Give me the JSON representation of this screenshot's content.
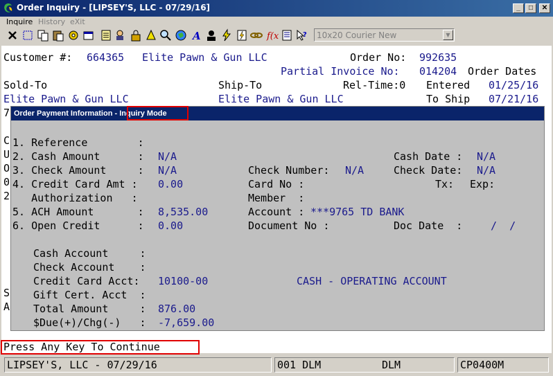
{
  "window": {
    "title": "Order Inquiry - [LIPSEY'S, LLC - 07/29/16]",
    "minimize": "_",
    "maximize": "□",
    "close": "✕"
  },
  "menu": {
    "inquire": "Inquire",
    "history": "History",
    "exit": "eXit"
  },
  "toolbar": {
    "font_select": "10x20 Courier New"
  },
  "header": {
    "customer_label": "Customer #:",
    "customer_number": "664365",
    "customer_name": "Elite Pawn & Gun LLC",
    "order_no_label": "Order No:",
    "order_no": "992635",
    "partial_invoice_label": "Partial Invoice No:",
    "partial_invoice_no": "014204",
    "order_dates_label": "Order Dates",
    "sold_to_label": "Sold-To",
    "ship_to_label": "Ship-To",
    "rel_time_label": "Rel-Time:0",
    "entered_label": "Entered",
    "entered_date": "01/25/16",
    "sold_to_name": "Elite Pawn & Gun LLC",
    "ship_to_name": "Elite Pawn & Gun LLC",
    "to_ship_label": "To Ship",
    "to_ship_date": "07/21/16"
  },
  "background_fragments": {
    "r1": "7",
    "r2": "C",
    "r3": "U",
    "r4": "O",
    "r5": "0",
    "r6": "2",
    "r7": "S",
    "r8": "A"
  },
  "dialog": {
    "title": "Order Payment Information - ",
    "mode": "Inquiry Mode",
    "fields": {
      "reference_label": "1. Reference        :",
      "cash_amount_label": "2. Cash Amount      :",
      "cash_amount": "N/A",
      "cash_date_label": "Cash Date :",
      "cash_date": "N/A",
      "check_amount_label": "3. Check Amount     :",
      "check_amount": "N/A",
      "check_number_label": "Check Number:",
      "check_number": "N/A",
      "check_date_label": "Check Date:",
      "check_date": "N/A",
      "cc_amt_label": "4. Credit Card Amt :",
      "cc_amt": "0.00",
      "card_no_label": "Card No :",
      "tx_label": "Tx:",
      "exp_label": "Exp:",
      "authorization_label": "   Authorization   :",
      "member_label": "Member  :",
      "ach_amount_label": "5. ACH Amount       :",
      "ach_amount": "8,535.00",
      "account_label": "Account :",
      "account_value": "***9765 TD BANK",
      "open_credit_label": "6. Open Credit      :",
      "open_credit": "0.00",
      "document_no_label": "Document No :",
      "doc_date_label": "Doc Date  :",
      "doc_date": "/  /",
      "cash_account_label": "Cash Account     :",
      "check_account_label": "Check Account    :",
      "cc_acct_label": "Credit Card Acct:",
      "cc_acct": "10100-00",
      "cc_acct_desc": "CASH - OPERATING ACCOUNT",
      "gift_cert_label": "Gift Cert. Acct  :",
      "total_amount_label": "Total Amount     :",
      "total_amount": "876.00",
      "due_chg_label": "$Due(+)/Chg(-)   :",
      "due_chg": "-7,659.00"
    }
  },
  "prompt": "Press Any Key To Continue",
  "status": {
    "company": "LIPSEY'S, LLC - 07/29/16",
    "user": "001 DLM",
    "user2": "DLM",
    "program": "CP0400M"
  },
  "colors": {
    "title_bar": "#0a246a",
    "data_blue": "#1a1a8c",
    "highlight_red": "#e00000"
  }
}
